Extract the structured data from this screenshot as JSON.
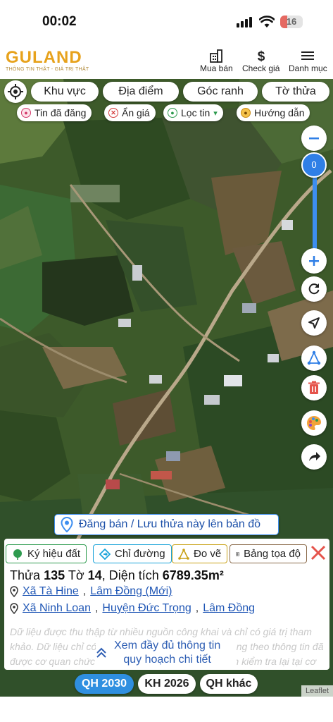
{
  "status_bar": {
    "time": "00:02",
    "battery": "16"
  },
  "header": {
    "logo_name": "GULAND",
    "logo_tagline": "THÔNG TIN THẬT - GIÁ TRỊ THẬT",
    "nav": [
      {
        "label": "Mua bán",
        "icon": "building-icon"
      },
      {
        "label": "Check giá",
        "icon": "dollar-icon"
      },
      {
        "label": "Danh mục",
        "icon": "hamburger-menu-icon"
      }
    ]
  },
  "map_toolbar": {
    "pills": [
      "Khu vực",
      "Địa điểm",
      "Góc ranh",
      "Tờ thửa"
    ],
    "chips": [
      {
        "label": "Tin đã đăng",
        "icon": "palette-icon"
      },
      {
        "label": "Ẩn giá",
        "icon": "close-circle-icon"
      },
      {
        "label": "Lọc tin",
        "icon": "location-pin-icon"
      },
      {
        "label": "Hướng dẫn",
        "icon": "guide-icon"
      }
    ]
  },
  "zoom": {
    "level": "0"
  },
  "post_bar": {
    "label": "Đăng bán / Lưu thửa này lên bản đồ"
  },
  "panel": {
    "tools": [
      {
        "label": "Ký hiệu đất",
        "icon": "leaf-icon",
        "color": "#2e9b4f"
      },
      {
        "label": "Chỉ đường",
        "icon": "directions-icon",
        "color": "#1aa3d9"
      },
      {
        "label": "Đo vẽ",
        "icon": "measure-icon",
        "color": "#c9a217"
      },
      {
        "label": "Bảng tọa độ",
        "icon": "table-icon",
        "color": "#8a6a4a"
      }
    ],
    "parcel": {
      "prefix_thua": "Thửa",
      "thua": "135",
      "prefix_to": "Tờ",
      "to": "14",
      "prefix_area": ", Diện tích",
      "area": "6789.35m²"
    },
    "address_new": {
      "commune": "Xã Tà Hine",
      "province": "Lâm Đồng (Mới)"
    },
    "address_old": {
      "commune": "Xã Ninh Loan",
      "district": "Huyện Đức Trọng",
      "province": "Lâm Đồng"
    },
    "note": "Dữ liệu được thu thập từ nhiều nguồn công khai và chỉ có giá trị tham khảo. Dữ liệu chỉ có ý nghĩa tham khảo và không dùng theo thông tin đã được cơ quan chức năng xác nhận. Người dùng nên kiểm tra lại tại cơ quan nhà nước.",
    "more_line1": "Xem đầy đủ thông tin",
    "more_line2": "quy hoạch chi tiết"
  },
  "plan_buttons": [
    "QH 2030",
    "KH 2026",
    "QH khác"
  ],
  "attribution": "Leaflet",
  "colors": {
    "accent": "#2f7fe6",
    "brand": "#e7a21c",
    "danger": "#e5534b"
  }
}
